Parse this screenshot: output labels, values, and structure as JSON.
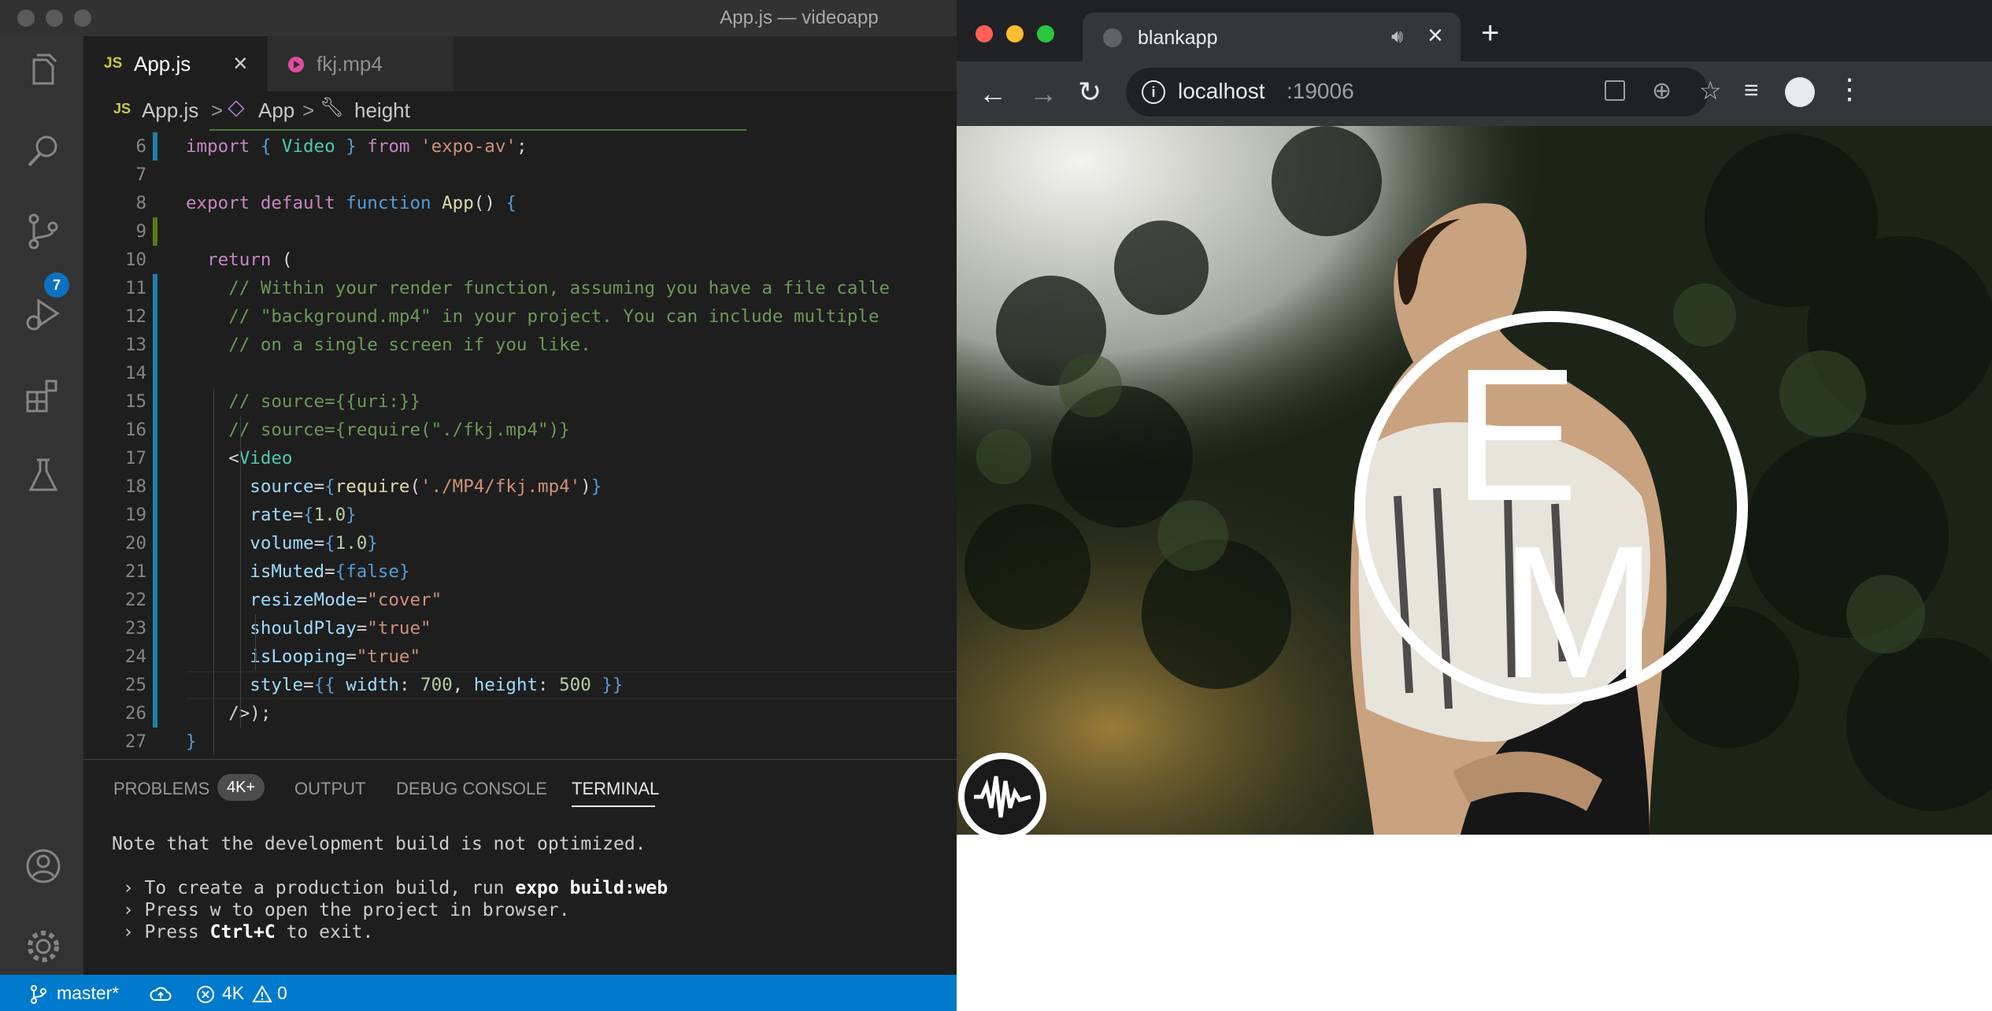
{
  "vscode": {
    "window_title": "App.js — videoapp",
    "activity_badge": "7",
    "tabs": [
      {
        "label": "App.js",
        "icon_text": "JS"
      },
      {
        "label": "fkj.mp4"
      }
    ],
    "breadcrumb": {
      "file_icon_text": "JS",
      "file": "App.js",
      "symbol1": "App",
      "symbol2": "height",
      "sep": ">"
    },
    "code_lines": [
      {
        "n": "6",
        "text": "import { Video } from 'expo-av';"
      },
      {
        "n": "7",
        "text": ""
      },
      {
        "n": "8",
        "text": "export default function App() {"
      },
      {
        "n": "9",
        "text": ""
      },
      {
        "n": "10",
        "text": "  return ("
      },
      {
        "n": "11",
        "text": "    // Within your render function, assuming you have a file calle"
      },
      {
        "n": "12",
        "text": "    // \"background.mp4\" in your project. You can include multiple"
      },
      {
        "n": "13",
        "text": "    // on a single screen if you like."
      },
      {
        "n": "14",
        "text": ""
      },
      {
        "n": "15",
        "text": "    // source={{uri:}}"
      },
      {
        "n": "16",
        "text": "    // source={require(\"./fkj.mp4\")}"
      },
      {
        "n": "17",
        "text": "    <Video"
      },
      {
        "n": "18",
        "text": "      source={require('./MP4/fkj.mp4')}"
      },
      {
        "n": "19",
        "text": "      rate={1.0}"
      },
      {
        "n": "20",
        "text": "      volume={1.0}"
      },
      {
        "n": "21",
        "text": "      isMuted={false}"
      },
      {
        "n": "22",
        "text": "      resizeMode=\"cover\""
      },
      {
        "n": "23",
        "text": "      shouldPlay=\"true\""
      },
      {
        "n": "24",
        "text": "      isLooping=\"true\""
      },
      {
        "n": "25",
        "text": "      style={{ width: 700, height: 500 }}"
      },
      {
        "n": "26",
        "text": "    />);"
      },
      {
        "n": "27",
        "text": "}"
      }
    ],
    "panel": {
      "tabs": [
        "PROBLEMS",
        "OUTPUT",
        "DEBUG CONSOLE",
        "TERMINAL"
      ],
      "problems_badge": "4K+",
      "active_tab": "TERMINAL",
      "terminal": {
        "line1": "Note that the development build is not optimized.",
        "line2_prefix": " › To create a production build, run ",
        "line2_cmd": "expo build:web",
        "line3": " › Press w to open the project in browser.",
        "line4_prefix": " › Press ",
        "line4_key": "Ctrl+C",
        "line4_suffix": " to exit."
      }
    },
    "statusbar": {
      "branch": "master*",
      "errors": "4K",
      "warnings": "0"
    }
  },
  "chrome": {
    "tab_title": "blankapp",
    "url_host": "localhost",
    "url_port": ":19006",
    "video_logo_text": [
      "E",
      "M"
    ]
  },
  "colors": {
    "vscode_bg": "#1e1e1e",
    "statusbar": "#007acc",
    "keyword": "#569cd6",
    "control": "#c586c0",
    "string": "#ce9178",
    "comment": "#6a9955",
    "attribute": "#9cdcfe",
    "number": "#b5cea8",
    "function": "#dcdcaa",
    "tag": "#4ec9b0",
    "modified_gutter": "#1b81a8",
    "chrome_dark": "#35363a"
  }
}
